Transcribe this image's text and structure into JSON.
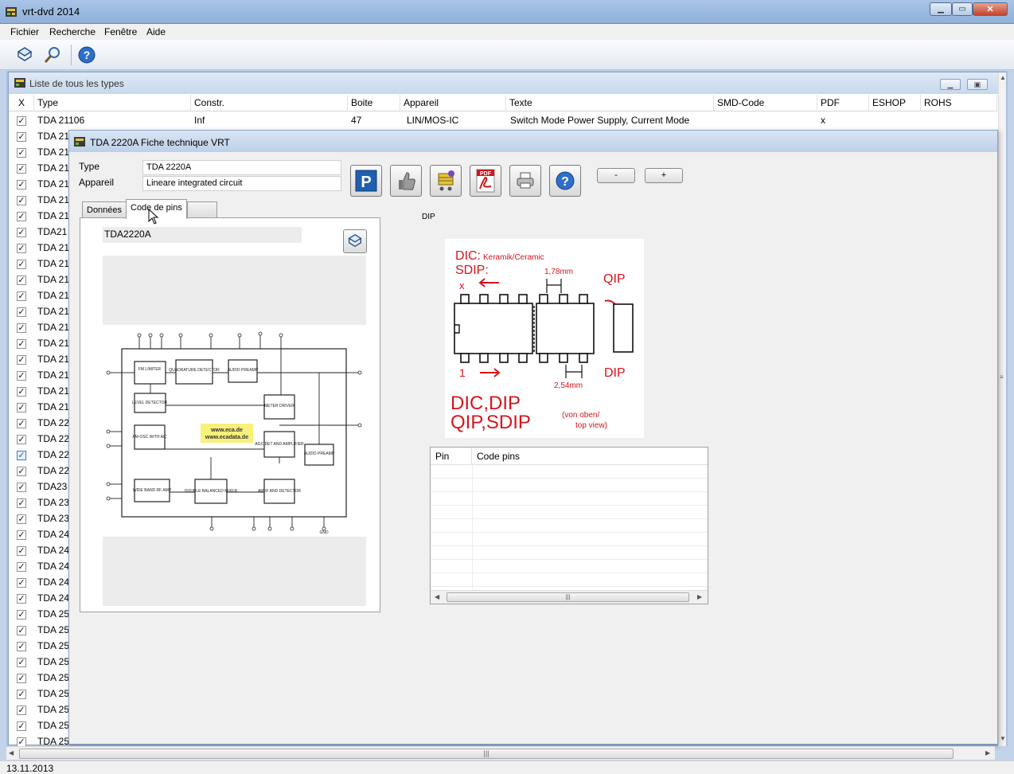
{
  "window": {
    "title": "vrt-dvd 2014"
  },
  "menu": {
    "items": [
      "Fichier",
      "Recherche",
      "Fenêtre",
      "Aide"
    ]
  },
  "toolbar": {
    "icons": [
      "book-icon",
      "magnifier-icon",
      "help-icon"
    ]
  },
  "list_window": {
    "title": "Liste de tous les types",
    "columns": [
      "X",
      "Type",
      "Constr.",
      "Boite",
      "Appareil",
      "Texte",
      "SMD-Code",
      "PDF",
      "ESHOP",
      "ROHS"
    ],
    "first_row": {
      "type": "TDA 21106",
      "constr": "Inf",
      "boite": "47",
      "appareil": "LIN/MOS-IC",
      "texte": "Switch Mode Power Supply, Current Mode",
      "smd": "",
      "pdf": "x",
      "eshop": "",
      "rohs": ""
    },
    "row_types": [
      "TDA 21",
      "TDA 21",
      "TDA 21",
      "TDA 21",
      "TDA 21",
      "TDA 21",
      "TDA21",
      "TDA 21",
      "TDA 21",
      "TDA 21",
      "TDA 21",
      "TDA 21",
      "TDA 21",
      "TDA 21",
      "TDA 21",
      "TDA 21",
      "TDA 21",
      "TDA 21",
      "TDA 22",
      "TDA 22",
      "TDA 22",
      "TDA 22",
      "TDA23",
      "TDA 23",
      "TDA 23",
      "TDA 24",
      "TDA 24",
      "TDA 24",
      "TDA 24",
      "TDA 24",
      "TDA 25",
      "TDA 25",
      "TDA 25",
      "TDA 25",
      "TDA 25",
      "TDA 25",
      "TDA 25",
      "TDA 25",
      "TDA 25"
    ],
    "highlighted_row": 20
  },
  "detail_window": {
    "title": "TDA 2220A Fiche technique VRT",
    "type_label": "Type",
    "type_value": "TDA 2220A",
    "appareil_label": "Appareil",
    "appareil_value": "Lineare integrated circuit",
    "tabs": [
      "Données",
      "Code de pins",
      ""
    ],
    "active_tab": "Code de pins",
    "minus_label": "-",
    "plus_label": "+",
    "panel_title": "TDA2220A",
    "package_label": "DIP",
    "pin_table": {
      "headers": [
        "Pin",
        "Code pins"
      ]
    }
  },
  "diagram": {
    "blocks": [
      "FM LIMITER",
      "QUADRATURE DETECTOR",
      "AUDIO PREAMP",
      "LEVEL DETECTOR",
      "METER DRIVER",
      "AM-OSC WITH AlC",
      "AGC DET AND AMPLIFIER",
      "AUDIO PREAMP",
      "WIDE BAND RF AMP",
      "DOUBLE BALANCED MIXER",
      "AM-IF AND DETECTOR"
    ],
    "watermark": [
      "www.eca.de",
      "www.ecadata.de"
    ],
    "gnd": "GND"
  },
  "package": {
    "lines": [
      "DIC:",
      "Keramik/Ceramic",
      "SDIP:",
      "1,78mm",
      "QIP",
      "x",
      "1",
      "2,54mm",
      "DIP",
      "DIC,DIP",
      "QIP,SDIP",
      "(von oben/",
      "top view)"
    ]
  },
  "status": {
    "date": "13.11.2013"
  },
  "colors": {
    "accent": "#1f5fb1",
    "package_red": "#d8141c"
  }
}
